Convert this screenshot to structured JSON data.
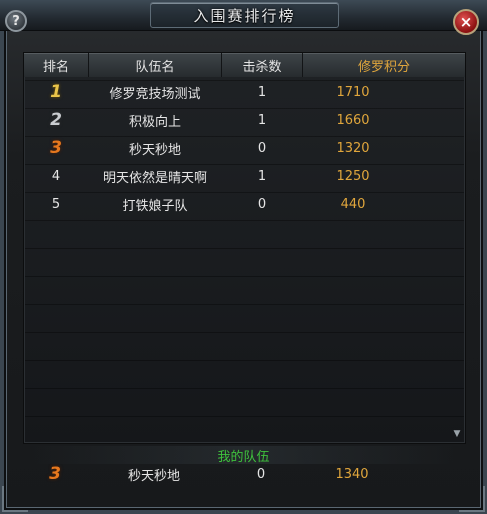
{
  "window": {
    "title": "入围赛排行榜",
    "help_label": "?",
    "close_label": "×"
  },
  "table": {
    "headers": {
      "rank": "排名",
      "team": "队伍名",
      "kills": "击杀数",
      "points": "修罗积分"
    },
    "rows": [
      {
        "rank": "1",
        "team": "修罗竞技场测试",
        "kills": "1",
        "points": "1710"
      },
      {
        "rank": "2",
        "team": "积极向上",
        "kills": "1",
        "points": "1660"
      },
      {
        "rank": "3",
        "team": "秒天秒地",
        "kills": "0",
        "points": "1320"
      },
      {
        "rank": "4",
        "team": "明天依然是晴天啊",
        "kills": "1",
        "points": "1250"
      },
      {
        "rank": "5",
        "team": "打铁娘子队",
        "kills": "0",
        "points": "440"
      }
    ]
  },
  "my_team": {
    "label": "我的队伍",
    "rank": "3",
    "team": "秒天秒地",
    "kills": "0",
    "points": "1340"
  },
  "colors": {
    "gold": "#e0a63c",
    "green": "#3ec23c",
    "medal_gold": "#e9c44a",
    "medal_silver": "#c9ccd0",
    "medal_bronze": "#e6781e"
  }
}
